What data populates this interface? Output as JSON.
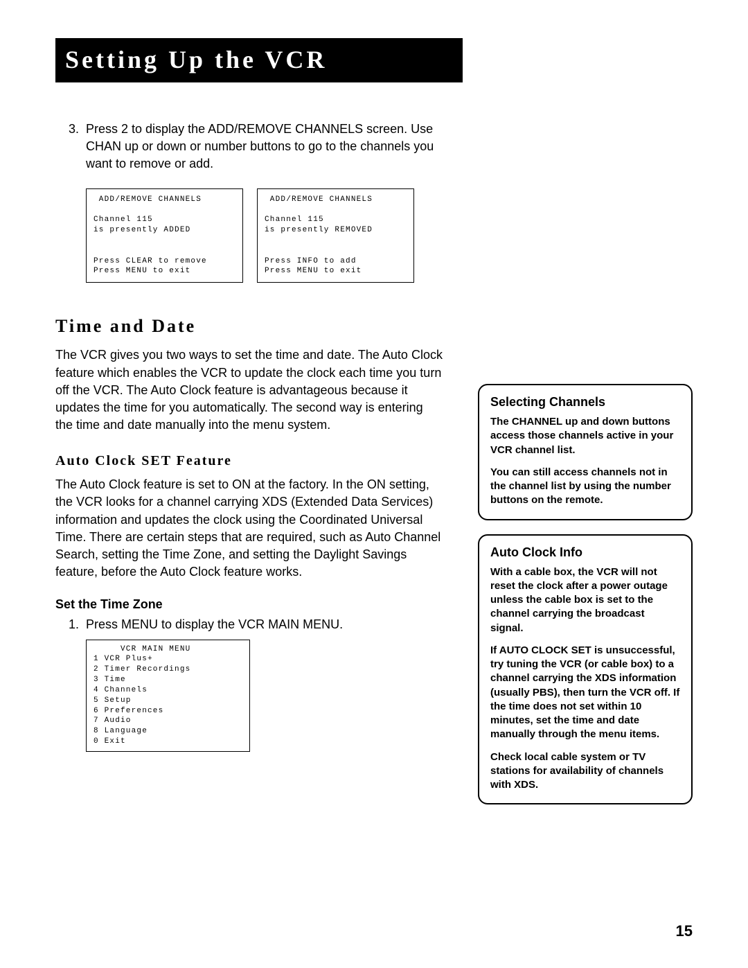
{
  "header": {
    "title": "Setting Up the VCR"
  },
  "step3": {
    "num": "3.",
    "text": "Press 2 to display the ADD/REMOVE CHANNELS screen. Use CHAN up or down or number buttons to go to the channels you want to remove or add."
  },
  "osd_added": " ADD/REMOVE CHANNELS\n\nChannel 115\nis presently ADDED\n\n\nPress CLEAR to remove\nPress MENU to exit",
  "osd_removed": " ADD/REMOVE CHANNELS\n\nChannel 115\nis presently REMOVED\n\n\nPress INFO to add\nPress MENU to exit",
  "time_date": {
    "heading": "Time and Date",
    "body": "The VCR gives you two ways to set the time and date. The Auto Clock feature which enables the VCR to update the clock each time you turn off the VCR. The Auto Clock feature is advantageous because it updates the time for you automatically. The second way is entering the time and date manually into the menu system."
  },
  "autoclock_set": {
    "heading": "Auto Clock SET Feature",
    "body": "The Auto Clock feature is set to ON at the factory. In the ON setting, the VCR looks for a channel carrying XDS (Extended Data Services) information and updates the clock using the Coordinated Universal Time. There are certain steps that are required, such as Auto Channel Search, setting the Time Zone, and setting the Daylight Savings feature, before the Auto Clock feature works."
  },
  "set_time_zone": {
    "heading": "Set the Time Zone",
    "step1_num": "1.",
    "step1_text": "Press MENU to display the VCR MAIN MENU."
  },
  "osd_main_menu": "     VCR MAIN MENU\n1 VCR Plus+\n2 Timer Recordings\n3 Time\n4 Channels\n5 Setup\n6 Preferences\n7 Audio\n8 Language\n0 Exit",
  "sidebar1": {
    "title": "Selecting Channels",
    "p1": "The CHANNEL up and down buttons access those channels active in your VCR channel list.",
    "p2": "You can still access channels not in the channel list by using the number buttons on the remote."
  },
  "sidebar2": {
    "title": "Auto Clock Info",
    "p1": "With a cable box, the VCR will not reset the clock after a power outage unless the cable box is set to the channel carrying the broadcast signal.",
    "p2": "If AUTO CLOCK SET is unsuccessful, try tuning the VCR (or cable box) to a channel carrying the XDS information (usually PBS), then turn the VCR off. If the time does not set within 10 minutes, set the time and date manually through the menu items.",
    "p3": "Check local cable system or TV stations for availability of channels with XDS."
  },
  "page_number": "15"
}
